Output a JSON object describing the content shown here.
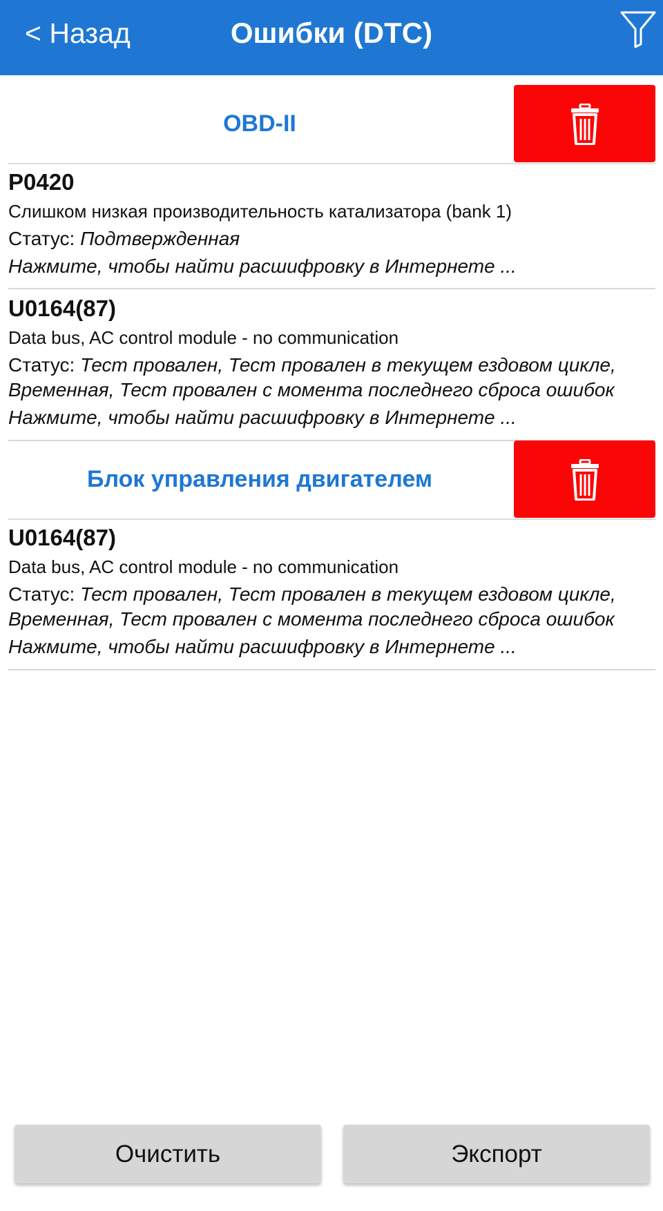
{
  "colors": {
    "header_bg": "#1f77d3",
    "section_title": "#1f77d3",
    "delete_bg": "#fb0606",
    "bottom_button_bg": "#d6d6d6"
  },
  "header": {
    "back_label": "< Назад",
    "title": "Ошибки (DTC)",
    "filter_icon": "filter-funnel-icon"
  },
  "sections": [
    {
      "title": "OBD-II",
      "delete_icon": "trash-icon",
      "items": [
        {
          "code": "P0420",
          "description": "Слишком низкая производительность катализатора (bank 1)",
          "status_label": "Статус: ",
          "status_value": "Подтвержденная",
          "link_text": "Нажмите, чтобы найти расшифровку в Интернете ..."
        },
        {
          "code": "U0164(87)",
          "description": "Data bus, AC control module - no communication",
          "status_label": "Статус: ",
          "status_value": "Тест провален, Тест провален в текущем ездовом цикле,\nВременная, Тест провален с момента последнего сброса ошибок",
          "link_text": "Нажмите, чтобы найти расшифровку в Интернете ..."
        }
      ]
    },
    {
      "title": "Блок управления двигателем",
      "delete_icon": "trash-icon",
      "items": [
        {
          "code": "U0164(87)",
          "description": "Data bus, AC control module - no communication",
          "status_label": "Статус: ",
          "status_value": "Тест провален, Тест провален в текущем ездовом цикле,\nВременная, Тест провален с момента последнего сброса ошибок",
          "link_text": "Нажмите, чтобы найти расшифровку в Интернете ..."
        }
      ]
    }
  ],
  "buttons": {
    "clear_label": "Очистить",
    "export_label": "Экспорт"
  }
}
